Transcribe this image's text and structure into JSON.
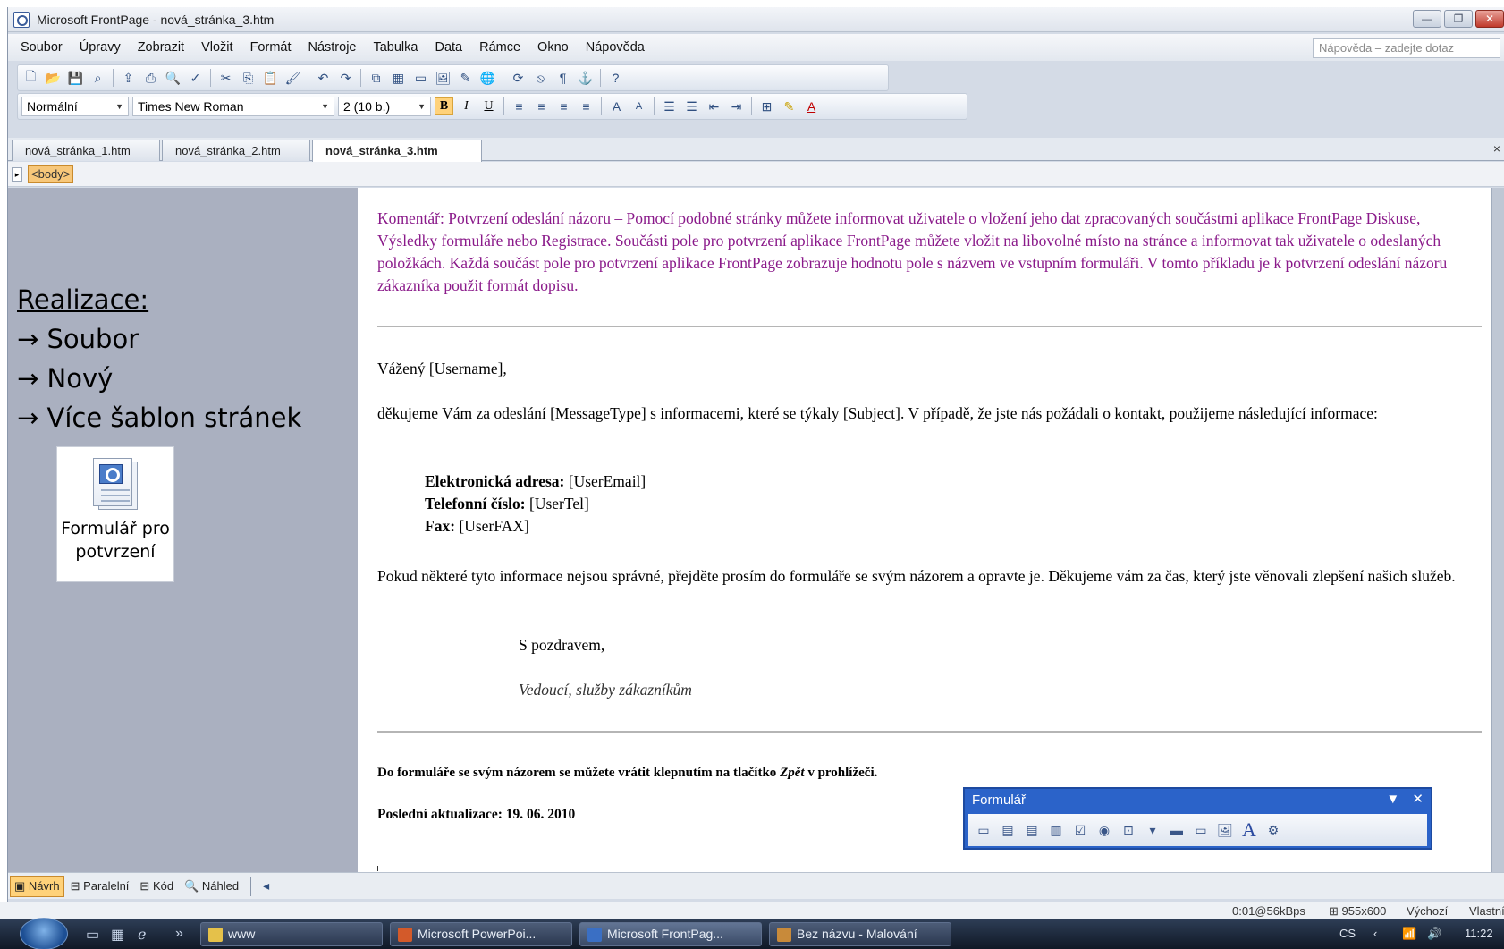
{
  "window": {
    "title": "Microsoft FrontPage - nová_stránka_3.htm",
    "controls": [
      "—",
      "❐",
      "✕"
    ]
  },
  "menu": {
    "items": [
      "Soubor",
      "Úpravy",
      "Zobrazit",
      "Vložit",
      "Formát",
      "Nástroje",
      "Tabulka",
      "Data",
      "Rámce",
      "Okno",
      "Nápověda"
    ],
    "help_placeholder": "Nápověda – zadejte dotaz"
  },
  "formatting": {
    "style": "Normální",
    "font": "Times New Roman",
    "size": "2 (10 b.)",
    "bold": "B",
    "italic": "I",
    "underline": "U"
  },
  "tabs": [
    "nová_stránka_1.htm",
    "nová_stránka_2.htm",
    "nová_stránka_3.htm"
  ],
  "active_tab_index": 2,
  "tagbar": {
    "tag": "<body>"
  },
  "left_panel": {
    "title": "Realizace:",
    "steps": [
      "→ Soubor",
      "→ Nový",
      "→ Více šablon stránek"
    ],
    "template_label_1": "Formulář pro",
    "template_label_2": "potvrzení"
  },
  "document": {
    "comment": "Komentář: Potvrzení odeslání názoru – Pomocí podobné stránky můžete informovat uživatele o vložení jeho dat zpracovaných součástmi aplikace FrontPage Diskuse, Výsledky formuláře nebo Registrace. Součásti pole pro potvrzení aplikace FrontPage můžete vložit na libovolné místo na stránce a informovat tak uživatele o odeslaných položkách. Každá součást pole pro potvrzení aplikace FrontPage zobrazuje hodnotu pole s názvem ve vstupním formuláři. V tomto příkladu je k potvrzení odeslání názoru zákazníka použit formát dopisu.",
    "greeting": "Vážený [Username],",
    "para1": "děkujeme Vám za odeslání [MessageType] s informacemi, které se týkaly [Subject]. V případě, že jste nás požádali o kontakt, použijeme následující informace:",
    "email_label": "Elektronická adresa:",
    "email_value": " [UserEmail]",
    "phone_label": "Telefonní číslo:",
    "phone_value": " [UserTel]",
    "fax_label": "Fax:",
    "fax_value": " [UserFAX]",
    "para2": "Pokud některé tyto informace nejsou správné, přejděte prosím do formuláře se svým názorem a opravte je. Děkujeme vám za čas, který jste věnovali zlepšení našich služeb.",
    "regards": "S pozdravem,",
    "signature": "Vedoucí, služby zákazníkům",
    "back_note_a": "Do formuláře se svým názorem se můžete vrátit klepnutím na tlačítko ",
    "back_note_b": "Zpět",
    "back_note_c": " v prohlížeči.",
    "updated": "Poslední aktualizace: 19. 06. 2010"
  },
  "form_toolbar": {
    "title": "Formulář",
    "dropdown": "▼",
    "close": "✕"
  },
  "view_tabs": [
    "Návrh",
    "Paralelní",
    "Kód",
    "Náhled"
  ],
  "status": {
    "speed": "0:01@56kBps",
    "resolution": "955x600",
    "default": "Výchozí",
    "custom": "Vlastní"
  },
  "taskbar": {
    "items": [
      "www",
      "Microsoft PowerPoi...",
      "Microsoft FrontPag...",
      "Bez názvu - Malování"
    ],
    "language": "CS",
    "time": "11:22"
  }
}
